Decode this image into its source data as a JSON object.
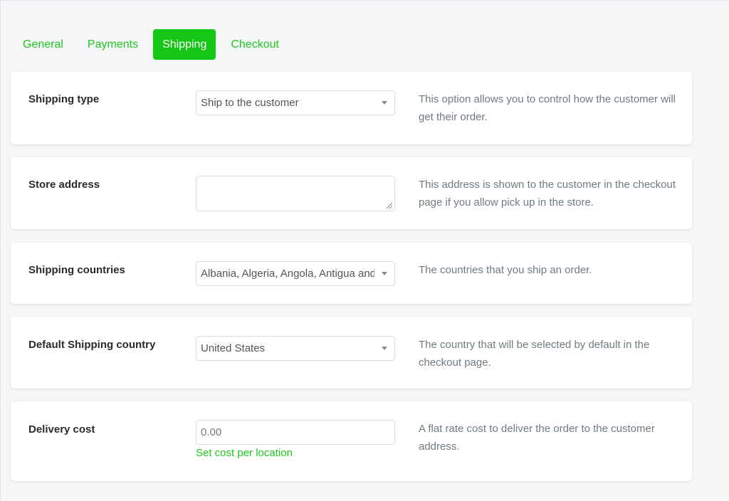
{
  "tabs": [
    {
      "label": "General",
      "active": false
    },
    {
      "label": "Payments",
      "active": false
    },
    {
      "label": "Shipping",
      "active": true
    },
    {
      "label": "Checkout",
      "active": false
    }
  ],
  "colors": {
    "accent": "#15c715",
    "link": "#1fc71f",
    "help_text": "#717a84"
  },
  "sections": {
    "shipping_type": {
      "label": "Shipping type",
      "value": "Ship to the customer",
      "help": "This option allows you to control how the customer will get their order."
    },
    "store_address": {
      "label": "Store address",
      "value": "",
      "help": "This address is shown to the customer in the checkout page if you allow pick up in the store."
    },
    "shipping_countries": {
      "label": "Shipping countries",
      "value": "Albania, Algeria, Angola, Antigua and",
      "help": "The countries that you ship an order."
    },
    "default_country": {
      "label": "Default Shipping country",
      "value": "United States",
      "help": "The country that will be selected by default in the checkout page."
    },
    "delivery_cost": {
      "label": "Delivery cost",
      "placeholder": "0.00",
      "link": "Set cost per location",
      "help": "A flat rate cost to deliver the order to the customer address."
    }
  }
}
